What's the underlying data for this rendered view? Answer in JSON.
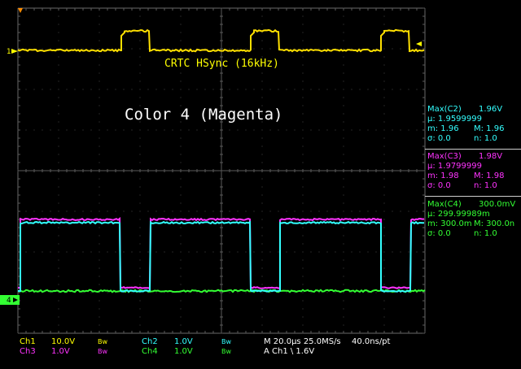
{
  "colors": {
    "ch1": "#ffe000",
    "ch2": "#3ff",
    "ch3": "#ff33ff",
    "ch4": "#33ff33",
    "grid": "#5a5a5a",
    "text": "#ffffff"
  },
  "markers": {
    "ch1": "1",
    "ch4": "4"
  },
  "labels": {
    "trace_title": "CRTC HSync (16kHz)",
    "color_title": "Color 4 (Magenta)"
  },
  "measurements": [
    {
      "title": "Max(C2)",
      "value": "1.96V",
      "mean": "µ: 1.9599999",
      "min": "m: 1.96",
      "max": "M: 1.96",
      "sigma": "σ: 0.0",
      "n": "n: 1.0",
      "color": "#33ffff"
    },
    {
      "title": "Max(C3)",
      "value": "1.98V",
      "mean": "µ: 1.9799999",
      "min": "m: 1.98",
      "max": "M: 1.98",
      "sigma": "σ: 0.0",
      "n": "n: 1.0",
      "color": "#ff33ff"
    },
    {
      "title": "Max(C4)",
      "value": "300.0mV",
      "mean": "µ: 299.99989m",
      "min": "m: 300.0m",
      "max": "M: 300.0n",
      "sigma": "σ: 0.0",
      "n": "n: 1.0",
      "color": "#33ff33"
    }
  ],
  "bottom": {
    "ch1": {
      "name": "Ch1",
      "scale": "10.0V",
      "bw": "Bw"
    },
    "ch2": {
      "name": "Ch2",
      "scale": "1.0V",
      "bw": "Bw"
    },
    "ch3": {
      "name": "Ch3",
      "scale": "1.0V",
      "bw": "Bw"
    },
    "ch4": {
      "name": "Ch4",
      "scale": "1.0V",
      "bw": "Bw"
    },
    "horizontal": "M 20.0µs 25.0MS/s",
    "sample": "40.0ns/pt",
    "trigger": "A  Ch1  \\  1.6V"
  }
}
